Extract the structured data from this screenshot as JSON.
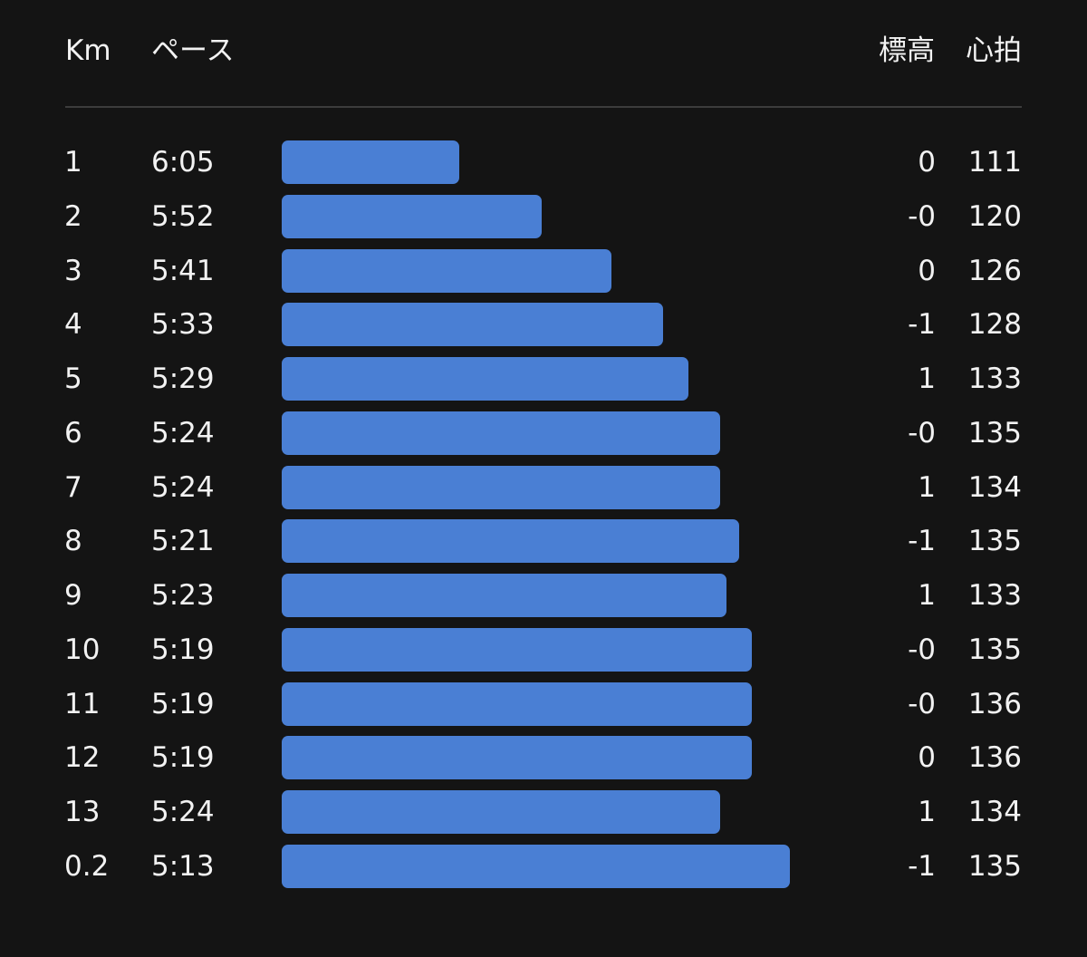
{
  "header": {
    "km": "Km",
    "pace": "ペース",
    "elevation": "標高",
    "heart_rate": "心拍"
  },
  "colors": {
    "background": "#141414",
    "bar": "#4a7fd4",
    "text": "#f2f2f2",
    "divider": "#3c3c3c"
  },
  "splits": [
    {
      "km": "1",
      "pace": "6:05",
      "elevation": "0",
      "heart_rate": "111"
    },
    {
      "km": "2",
      "pace": "5:52",
      "elevation": "-0",
      "heart_rate": "120"
    },
    {
      "km": "3",
      "pace": "5:41",
      "elevation": "0",
      "heart_rate": "126"
    },
    {
      "km": "4",
      "pace": "5:33",
      "elevation": "-1",
      "heart_rate": "128"
    },
    {
      "km": "5",
      "pace": "5:29",
      "elevation": "1",
      "heart_rate": "133"
    },
    {
      "km": "6",
      "pace": "5:24",
      "elevation": "-0",
      "heart_rate": "135"
    },
    {
      "km": "7",
      "pace": "5:24",
      "elevation": "1",
      "heart_rate": "134"
    },
    {
      "km": "8",
      "pace": "5:21",
      "elevation": "-1",
      "heart_rate": "135"
    },
    {
      "km": "9",
      "pace": "5:23",
      "elevation": "1",
      "heart_rate": "133"
    },
    {
      "km": "10",
      "pace": "5:19",
      "elevation": "-0",
      "heart_rate": "135"
    },
    {
      "km": "11",
      "pace": "5:19",
      "elevation": "-0",
      "heart_rate": "136"
    },
    {
      "km": "12",
      "pace": "5:19",
      "elevation": "0",
      "heart_rate": "136"
    },
    {
      "km": "13",
      "pace": "5:24",
      "elevation": "1",
      "heart_rate": "134"
    },
    {
      "km": "0.2",
      "pace": "5:13",
      "elevation": "-1",
      "heart_rate": "135"
    }
  ]
}
